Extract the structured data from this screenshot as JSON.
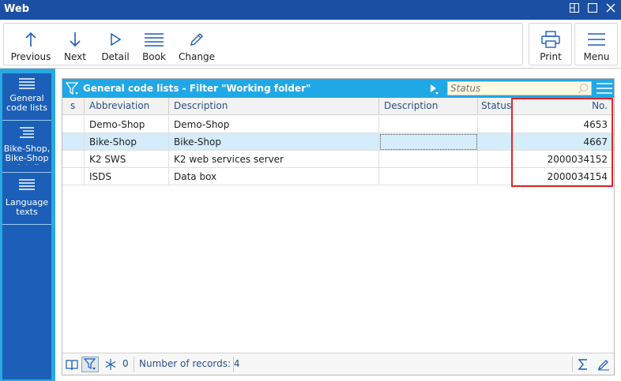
{
  "window": {
    "title": "Web"
  },
  "toolbar": {
    "previous": "Previous",
    "next": "Next",
    "detail": "Detail",
    "book": "Book",
    "change": "Change",
    "print": "Print",
    "menu": "Menu"
  },
  "sidebar": {
    "items": [
      {
        "label": "General code lists"
      },
      {
        "label": "Bike-Shop, Bike-Shop detail"
      },
      {
        "label": "Language texts"
      }
    ]
  },
  "panel": {
    "title": "General code lists - Filter \"Working folder\"",
    "status_placeholder": "Status",
    "columns": [
      "s",
      "Abbreviation",
      "Description",
      "Description",
      "Status",
      "No."
    ],
    "rows": [
      {
        "abbr": "Demo-Shop",
        "desc": "Demo-Shop",
        "no": "4653"
      },
      {
        "abbr": "Bike-Shop",
        "desc": "Bike-Shop",
        "no": "4667"
      },
      {
        "abbr": "K2 SWS",
        "desc": "K2 web services server",
        "no": "2000034152"
      },
      {
        "abbr": "ISDS",
        "desc": "Data box",
        "no": "2000034154"
      }
    ],
    "footer": {
      "filter_count": "0",
      "records": "Number of records: 4"
    }
  },
  "colors": {
    "titlebar": "#1a4fa3",
    "accent": "#20a8e6",
    "sidebar": "#1b5fb8",
    "highlight": "#e0262b"
  }
}
